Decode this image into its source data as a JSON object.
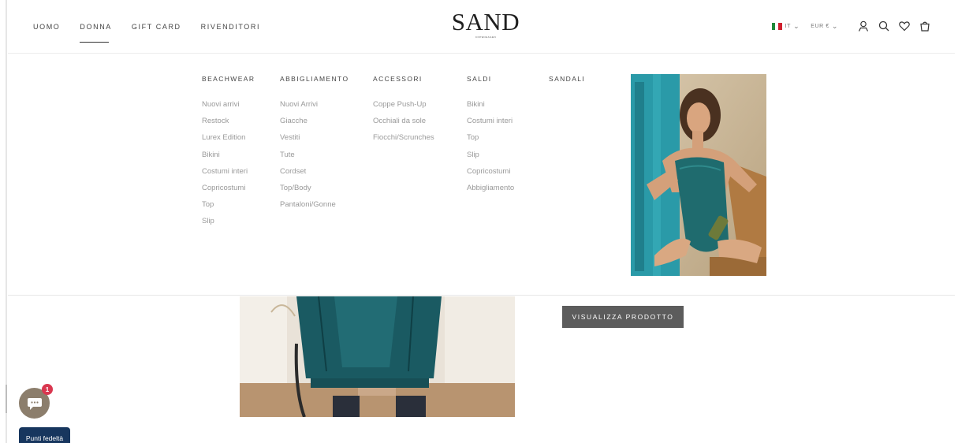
{
  "nav": {
    "items": [
      {
        "label": "UOMO",
        "active": false
      },
      {
        "label": "DONNA",
        "active": true
      },
      {
        "label": "GIFT CARD",
        "active": false
      },
      {
        "label": "RIVENDITORI",
        "active": false
      }
    ]
  },
  "logo": {
    "main": "SAND",
    "sub": "COPENHAGEN"
  },
  "tools": {
    "language": "IT",
    "currency": "EUR €",
    "icons": [
      "account-icon",
      "search-icon",
      "wishlist-icon",
      "cart-icon"
    ]
  },
  "mega_menu": {
    "columns": [
      {
        "title": "BEACHWEAR",
        "links": [
          "Nuovi arrivi",
          "Restock",
          "Lurex Edition",
          "Bikini",
          "Costumi interi",
          "Copricostumi",
          "Top",
          "Slip"
        ]
      },
      {
        "title": "ABBIGLIAMENTO",
        "links": [
          "Nuovi Arrivi",
          "Giacche",
          "Vestiti",
          "Tute",
          "Cordset",
          "Top/Body",
          "Pantaloni/Gonne"
        ]
      },
      {
        "title": "ACCESSORI",
        "links": [
          "Coppe Push-Up",
          "Occhiali da sole",
          "Fiocchi/Scrunches"
        ]
      },
      {
        "title": "SALDI",
        "links": [
          "Bikini",
          "Costumi interi",
          "Top",
          "Slip",
          "Copricostumi",
          "Abbigliamento"
        ]
      },
      {
        "title": "SANDALI",
        "links": []
      }
    ]
  },
  "cta": {
    "label": "VISUALIZZA PRODOTTO"
  },
  "chat": {
    "badge_count": "1"
  },
  "loyalty": {
    "label": "Punti fedeltà"
  },
  "colors": {
    "accent_dark": "#5c5c5c",
    "loyalty": "#17365e",
    "badge": "#d9374f",
    "teal": "#1f6b6e"
  }
}
